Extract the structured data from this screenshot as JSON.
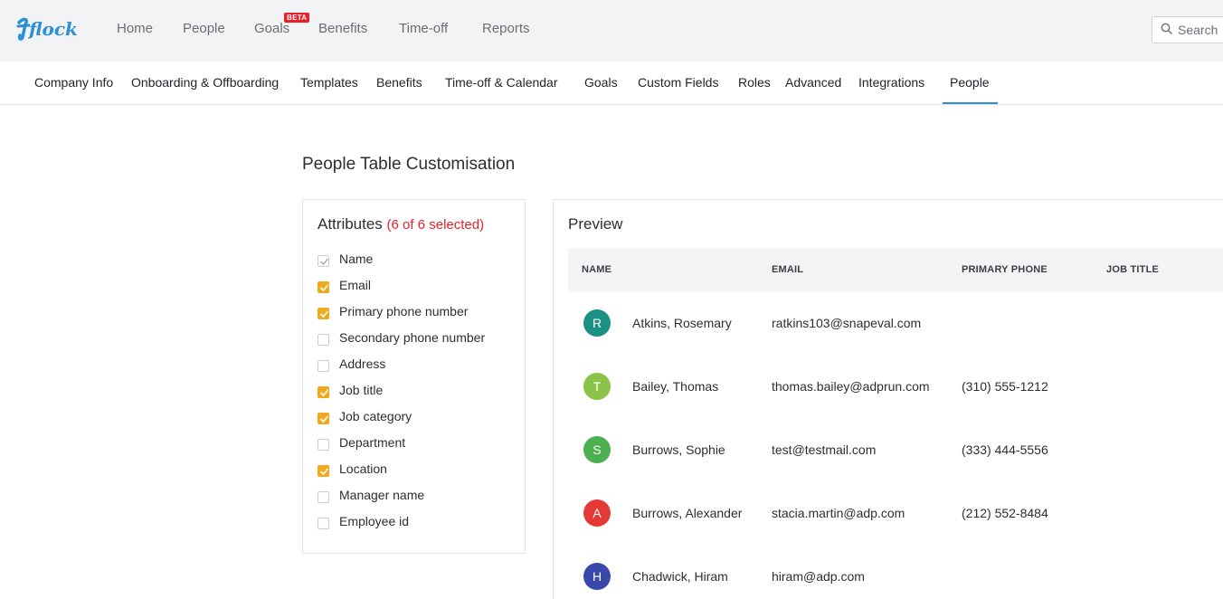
{
  "app": {
    "logo_text": "flock"
  },
  "topnav": {
    "items": [
      {
        "label": "Home"
      },
      {
        "label": "People"
      },
      {
        "label": "Goals"
      },
      {
        "label": "Benefits"
      },
      {
        "label": "Time-off"
      },
      {
        "label": "Reports"
      }
    ],
    "beta_badge": "BETA",
    "search_label": "Search"
  },
  "subnav": {
    "items": [
      {
        "label": "Company Info"
      },
      {
        "label": "Onboarding & Offboarding"
      },
      {
        "label": "Templates"
      },
      {
        "label": "Benefits"
      },
      {
        "label": "Time-off & Calendar"
      },
      {
        "label": "Goals"
      },
      {
        "label": "Custom Fields"
      },
      {
        "label": "Roles"
      },
      {
        "label": "Advanced"
      },
      {
        "label": "Integrations"
      },
      {
        "label": "People"
      }
    ],
    "active": "People"
  },
  "page": {
    "title": "People Table Customisation"
  },
  "attributes": {
    "title": "Attributes",
    "count": "(6 of 6 selected)",
    "items": [
      {
        "label": "Name",
        "checked": true,
        "disabled": true
      },
      {
        "label": "Email",
        "checked": true
      },
      {
        "label": "Primary phone number",
        "checked": true
      },
      {
        "label": "Secondary phone number",
        "checked": false
      },
      {
        "label": "Address",
        "checked": false
      },
      {
        "label": "Job title",
        "checked": true
      },
      {
        "label": "Job category",
        "checked": true
      },
      {
        "label": "Department",
        "checked": false
      },
      {
        "label": "Location",
        "checked": true
      },
      {
        "label": "Manager name",
        "checked": false
      },
      {
        "label": "Employee id",
        "checked": false
      }
    ]
  },
  "preview": {
    "title": "Preview",
    "columns": [
      "NAME",
      "EMAIL",
      "PRIMARY PHONE",
      "JOB TITLE"
    ],
    "rows": [
      {
        "initial": "R",
        "color": "#1b9183",
        "name": "Atkins, Rosemary",
        "email": "ratkins103@snapeval.com",
        "phone": ""
      },
      {
        "initial": "T",
        "color": "#8bc34a",
        "name": "Bailey, Thomas",
        "email": "thomas.bailey@adprun.com",
        "phone": "(310) 555-1212"
      },
      {
        "initial": "S",
        "color": "#4caf50",
        "name": "Burrows, Sophie",
        "email": "test@testmail.com",
        "phone": "(333) 444-5556"
      },
      {
        "initial": "A",
        "color": "#e53935",
        "name": "Burrows, Alexander",
        "email": "stacia.martin@adp.com",
        "phone": "(212) 552-8484"
      },
      {
        "initial": "H",
        "color": "#3949ab",
        "name": "Chadwick, Hiram",
        "email": "hiram@adp.com",
        "phone": ""
      }
    ]
  },
  "colors": {
    "accent": "#2d8fd5",
    "checkbox": "#f0a91e",
    "count": "#e8202a"
  }
}
